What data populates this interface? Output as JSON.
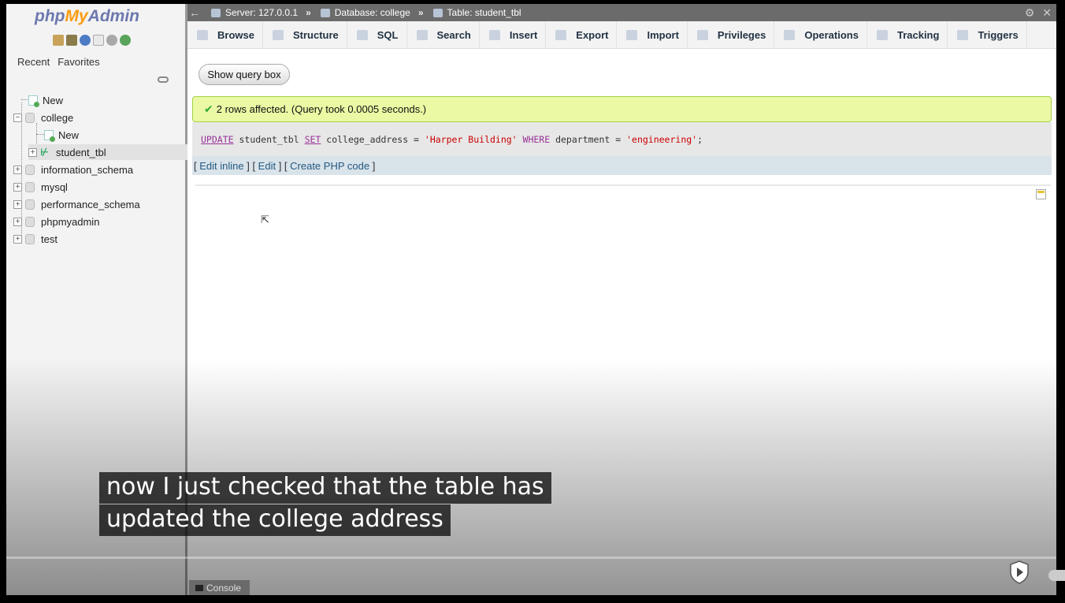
{
  "app": {
    "logo_php": "php",
    "logo_my": "My",
    "logo_admin": "Admin"
  },
  "nav": {
    "recent_label": "Recent",
    "favorites_label": "Favorites",
    "tree": {
      "new": "New",
      "college": "college",
      "college_new": "New",
      "student_tbl": "student_tbl",
      "information_schema": "information_schema",
      "mysql": "mysql",
      "performance_schema": "performance_schema",
      "phpmyadmin": "phpmyadmin",
      "test": "test"
    }
  },
  "breadcrumb": {
    "server": "Server: 127.0.0.1",
    "database": "Database: college",
    "table": "Table: student_tbl",
    "separator": "»"
  },
  "tabs": [
    "Browse",
    "Structure",
    "SQL",
    "Search",
    "Insert",
    "Export",
    "Import",
    "Privileges",
    "Operations",
    "Tracking",
    "Triggers"
  ],
  "content": {
    "show_query_button": "Show query box",
    "success_message": "2 rows affected. (Query took 0.0005 seconds.)",
    "sql": {
      "kw_update": "UPDATE",
      "table": " student_tbl ",
      "kw_set": "SET",
      "assign": " college_address = ",
      "value1": "'Harper Building'",
      "kw_where": " WHERE",
      "cond": " department = ",
      "value2": "'engineering'",
      "end": ";"
    },
    "links": {
      "edit_inline": "Edit inline",
      "edit": "Edit",
      "create_php": "Create PHP code"
    }
  },
  "console_label": "Console",
  "caption": {
    "line1": "now I just checked that the table has",
    "line2": "updated the college address"
  },
  "colors": {
    "accent": "#235a81",
    "success_bg": "#ebf8a4",
    "topbar": "#6b6b6b"
  }
}
